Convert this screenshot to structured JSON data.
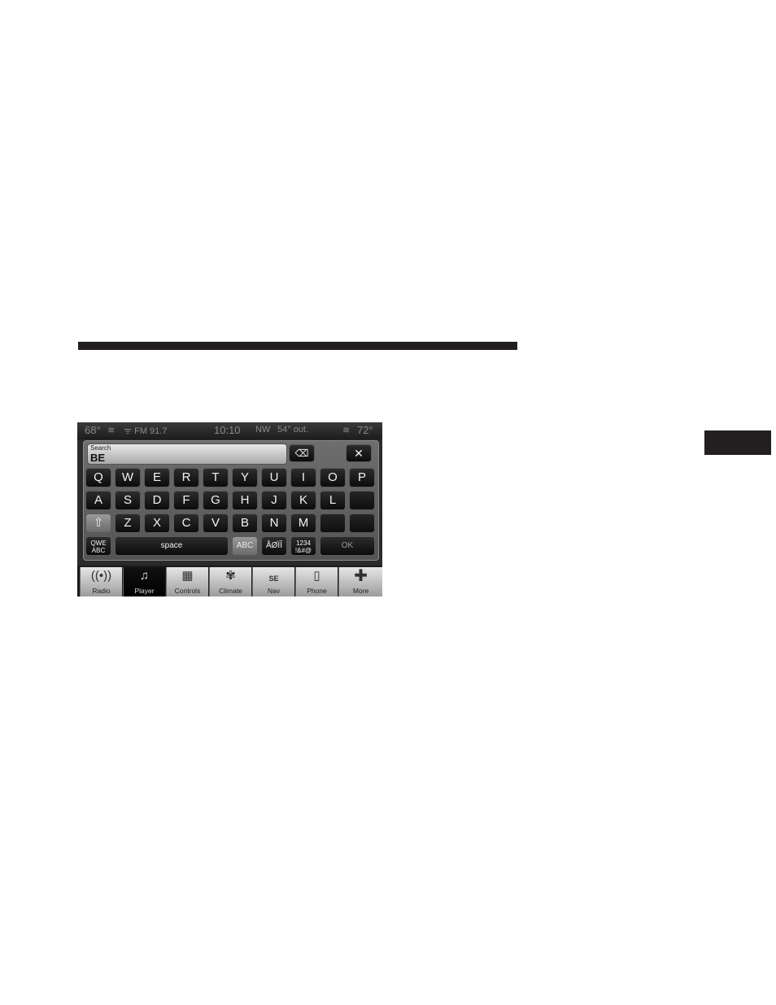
{
  "status_bar": {
    "temp_left": "68°",
    "radio": "FM 91.7",
    "time": "10:10",
    "compass": "NW",
    "outside_temp": "54° out.",
    "temp_right": "72°"
  },
  "search": {
    "label": "Search",
    "value": "BE"
  },
  "keyboard": {
    "row1": [
      "Q",
      "W",
      "E",
      "R",
      "T",
      "Y",
      "U",
      "I",
      "O",
      "P"
    ],
    "row2": [
      "A",
      "S",
      "D",
      "F",
      "G",
      "H",
      "J",
      "K",
      "L"
    ],
    "row3": [
      "Z",
      "X",
      "C",
      "V",
      "B",
      "N",
      "M"
    ],
    "backspace": "⌫",
    "close": "✕",
    "shift": "⇧",
    "layout_top": "QWE",
    "layout_bottom": "ABC",
    "space": "space",
    "abc": "ABC",
    "accents": "ÅØÏÎ",
    "numbers_top": "1234",
    "numbers_bottom": "!&#@",
    "ok": "OK"
  },
  "nav": {
    "radio": "Radio",
    "player": "Player",
    "controls": "Controls",
    "climate": "Climate",
    "nav": "Nav",
    "nav_compass": "SE",
    "phone": "Phone",
    "more": "More"
  }
}
